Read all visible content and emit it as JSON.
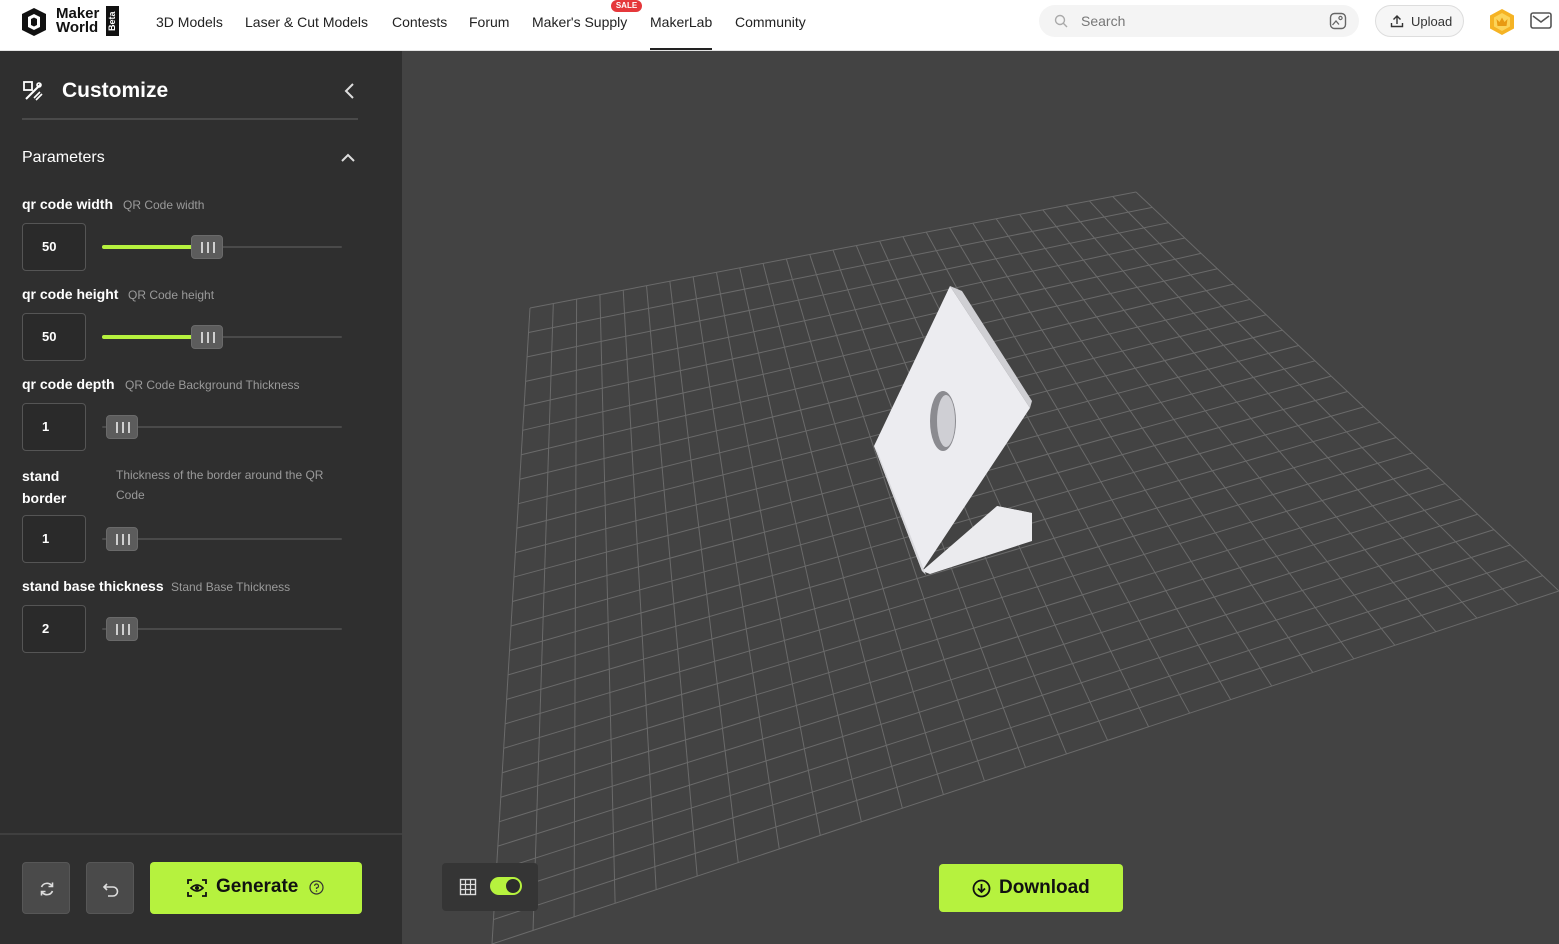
{
  "header": {
    "logo_text_line1": "Maker",
    "logo_text_line2": "World",
    "logo_badge": "Beta",
    "nav": [
      {
        "label": "3D Models"
      },
      {
        "label": "Laser & Cut Models"
      },
      {
        "label": "Contests"
      },
      {
        "label": "Forum"
      },
      {
        "label": "Maker's Supply",
        "badge": "SALE"
      },
      {
        "label": "MakerLab",
        "active": true
      },
      {
        "label": "Community"
      }
    ],
    "search_placeholder": "Search",
    "upload_label": "Upload"
  },
  "sidebar": {
    "title": "Customize",
    "section_title": "Parameters",
    "params": [
      {
        "name": "qr code width",
        "desc": "QR Code width",
        "value": "50",
        "fill_fraction": 0.37
      },
      {
        "name": "qr code height",
        "desc": "QR Code height",
        "value": "50",
        "fill_fraction": 0.37
      },
      {
        "name": "qr code depth",
        "desc": "QR Code Background Thickness",
        "value": "1",
        "fill_fraction": 0.0
      },
      {
        "name": "stand border",
        "desc": "Thickness of the border around the QR Code",
        "value": "1",
        "fill_fraction": 0.0
      },
      {
        "name": "stand base thickness",
        "desc": "Stand Base Thickness",
        "value": "2",
        "fill_fraction": 0.0
      }
    ],
    "generate_label": "Generate"
  },
  "viewport": {
    "grid_toggle_on": true,
    "download_label": "Download"
  },
  "colors": {
    "accent": "#b6f23e",
    "sidebar_bg": "#2f2f2f",
    "viewport_bg": "#434343",
    "sale_badge": "#e5383b"
  },
  "icons": [
    "logo-icon",
    "search-icon",
    "image-search-icon",
    "upload-icon",
    "crown-icon",
    "message-icon",
    "customize-icon",
    "chevron-left-icon",
    "chevron-up-icon",
    "reset-icon",
    "undo-icon",
    "generate-icon",
    "help-icon",
    "grid-icon",
    "download-icon"
  ]
}
